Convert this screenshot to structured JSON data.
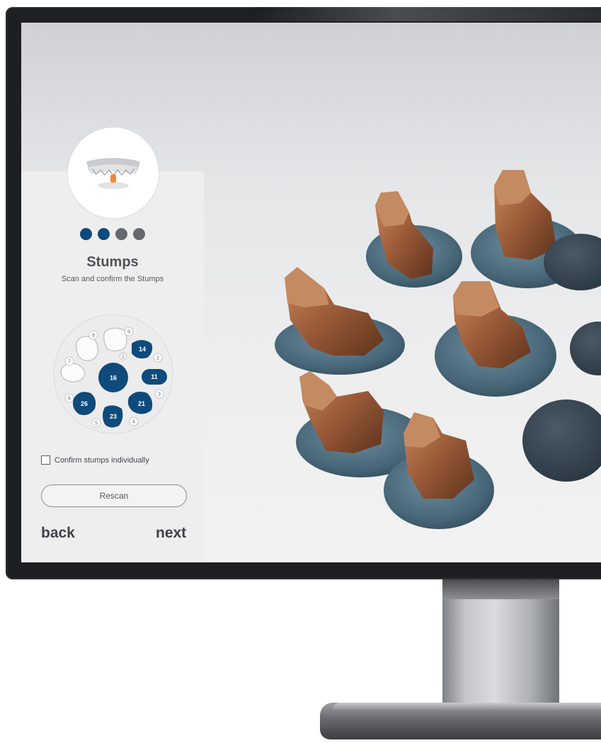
{
  "colors": {
    "accent": "#0e4a7c",
    "inactive_step": "#656970",
    "panel": "#eeeeef"
  },
  "wizard": {
    "steps_total": 4,
    "steps_completed": 2,
    "title": "Stumps",
    "subtitle": "Scan and confirm the Stumps",
    "confirm_label": "Confirm stumps individually",
    "confirm_checked": false,
    "rescan_label": "Rescan",
    "back_label": "back",
    "next_label": "next"
  },
  "tooth_map": {
    "selected": [
      "14",
      "11",
      "16",
      "26",
      "21",
      "23"
    ],
    "unselected": [
      "8",
      "9",
      "7",
      "1",
      "2",
      "3",
      "4",
      "5",
      "6"
    ]
  },
  "icons": {
    "step_badge": "dental-arch-model-icon",
    "scene": "3d-stump-scans"
  }
}
